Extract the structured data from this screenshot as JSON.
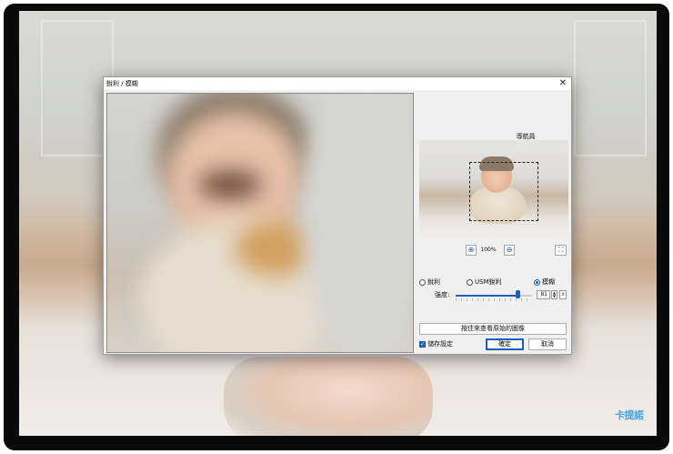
{
  "dialog": {
    "title": "銳利 / 模糊",
    "close_glyph": "✕",
    "navigator_label": "導航員",
    "zoom": "100%",
    "zoom_in_glyph": "⊕",
    "zoom_out_glyph": "⊖",
    "fit_glyph": "⛶",
    "modes": [
      {
        "label": "銳利",
        "selected": false
      },
      {
        "label": "USM銳利",
        "selected": false
      },
      {
        "label": "模糊",
        "selected": true
      }
    ],
    "strength_label": "強度:",
    "strength_value": "81",
    "strength_fraction": 0.81,
    "spin_up": "▲",
    "spin_down": "▼",
    "reset_glyph": "x",
    "hold_button": "按住來查看原始的圖像",
    "save_settings_label": "儲存設定",
    "save_settings_checked": true,
    "ok_label": "確定",
    "cancel_label": "取消"
  },
  "watermark": "卡提諾",
  "colors": {
    "accent": "#1a5fc0",
    "frame": "#0a0a0a"
  }
}
